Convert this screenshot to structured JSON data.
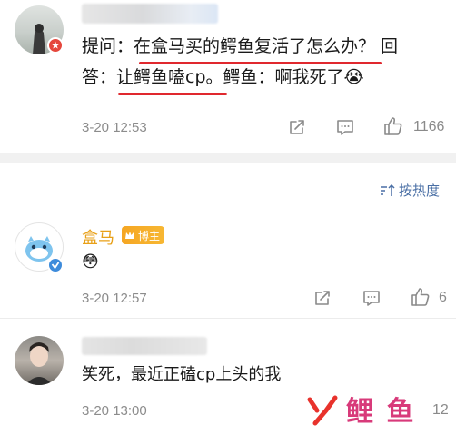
{
  "post": {
    "text_line1": "提问：在盒马买的鳄鱼复活了怎么办？ 回",
    "text_line2": "答：让鳄鱼嗑cp。鳄鱼：啊我死了😭",
    "time": "3-20 12:53",
    "likes": "1166"
  },
  "sort": {
    "label": "按热度"
  },
  "comments": [
    {
      "name": "盒马",
      "badge": "博主",
      "text": "😳",
      "time": "3-20 12:57",
      "likes": "6"
    },
    {
      "text": "笑死，最近正磕cp上头的我",
      "time": "3-20 13:00",
      "likes": "12"
    }
  ],
  "watermark": {
    "text": "鲤 鱼"
  },
  "colors": {
    "accent_red": "#e0282e",
    "hema_name": "#e8a018",
    "meta_gray": "#8c8c8c",
    "sort_blue": "#4a6fa5"
  }
}
